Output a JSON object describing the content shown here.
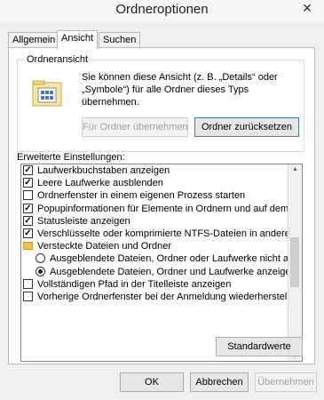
{
  "window": {
    "title": "Ordneroptionen",
    "close_glyph": "✕"
  },
  "tabs": [
    {
      "label": "Allgemein",
      "active": false
    },
    {
      "label": "Ansicht",
      "active": true
    },
    {
      "label": "Suchen",
      "active": false
    }
  ],
  "folder_view": {
    "legend": "Ordneransicht",
    "description": "Sie können diese Ansicht (z. B. „Details“ oder „Symbole“) für alle Ordner dieses Typs übernehmen.",
    "apply_button": "Für Ordner übernehmen",
    "reset_button": "Ordner zurücksetzen"
  },
  "advanced": {
    "label": "Erweiterte Einstellungen:",
    "items": [
      {
        "type": "checkbox",
        "checked": true,
        "label": "Laufwerkbuchstaben anzeigen"
      },
      {
        "type": "checkbox",
        "checked": true,
        "label": "Leere Laufwerke ausblenden"
      },
      {
        "type": "checkbox",
        "checked": false,
        "label": "Ordnerfenster in einem eigenen Prozess starten"
      },
      {
        "type": "checkbox",
        "checked": true,
        "label": "Popupinformationen für Elemente in Ordnern und auf dem Desk"
      },
      {
        "type": "checkbox",
        "checked": true,
        "label": "Statusleiste anzeigen"
      },
      {
        "type": "checkbox",
        "checked": true,
        "label": "Verschlüsselte oder komprimierte NTFS-Dateien in anderer Farb"
      },
      {
        "type": "folder",
        "label": "Versteckte Dateien und Ordner"
      },
      {
        "type": "radio",
        "selected": false,
        "label": "Ausgeblendete Dateien, Ordner oder Laufwerke nicht anze"
      },
      {
        "type": "radio",
        "selected": true,
        "label": "Ausgeblendete Dateien, Ordner und Laufwerke anzeigen"
      },
      {
        "type": "checkbox",
        "checked": false,
        "label": "Vollständigen Pfad in der Titelleiste anzeigen"
      },
      {
        "type": "checkbox",
        "checked": false,
        "label": "Vorherige Ordnerfenster bei der Anmeldung wiederherstellen"
      }
    ],
    "defaults_button": "Standardwerte"
  },
  "footer": {
    "ok": "OK",
    "cancel": "Abbrechen",
    "apply": "Übernehmen"
  }
}
